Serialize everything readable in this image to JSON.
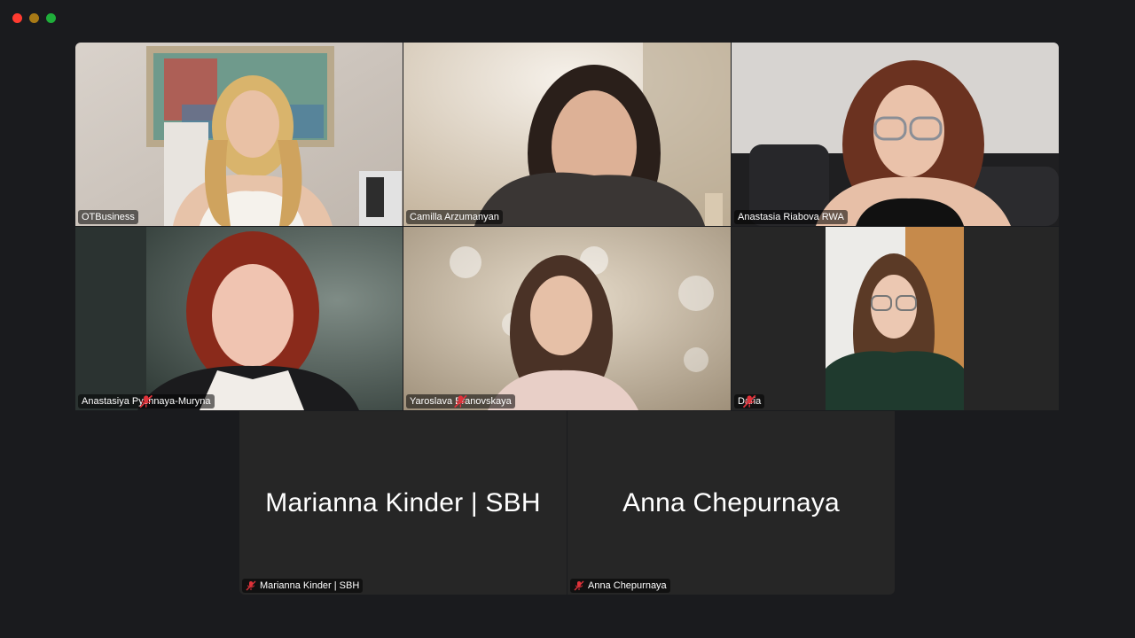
{
  "window": {
    "controls": [
      "close",
      "minimize",
      "maximize"
    ]
  },
  "participants": [
    {
      "name": "OTBusiness",
      "muted": false,
      "speaking": false,
      "video": true,
      "icon": "person-video"
    },
    {
      "name": "Camilla Arzumanyan",
      "muted": false,
      "speaking": true,
      "video": true,
      "icon": "person-video"
    },
    {
      "name": "Anastasia Riabova RWA",
      "muted": false,
      "speaking": false,
      "video": true,
      "icon": "person-video"
    },
    {
      "name": "Anastasiya Pyshnaya-Muryna",
      "muted": true,
      "speaking": false,
      "video": true,
      "icon": "person-video"
    },
    {
      "name": "Yaroslava Branovskaya",
      "muted": true,
      "speaking": false,
      "video": true,
      "icon": "person-video"
    },
    {
      "name": "Daria",
      "muted": true,
      "speaking": false,
      "video": true,
      "icon": "person-video"
    },
    {
      "name": "Marianna Kinder | SBH",
      "muted": true,
      "speaking": false,
      "video": false,
      "display_name": "Marianna Kinder | SBH"
    },
    {
      "name": "Anna Chepurnaya",
      "muted": true,
      "speaking": false,
      "video": false,
      "display_name": "Anna Chepurnaya"
    }
  ],
  "colors": {
    "speaking_border": "#2bc84a",
    "mute_icon": "#e0323a",
    "background": "#1a1b1e",
    "tile_background": "#262626"
  }
}
